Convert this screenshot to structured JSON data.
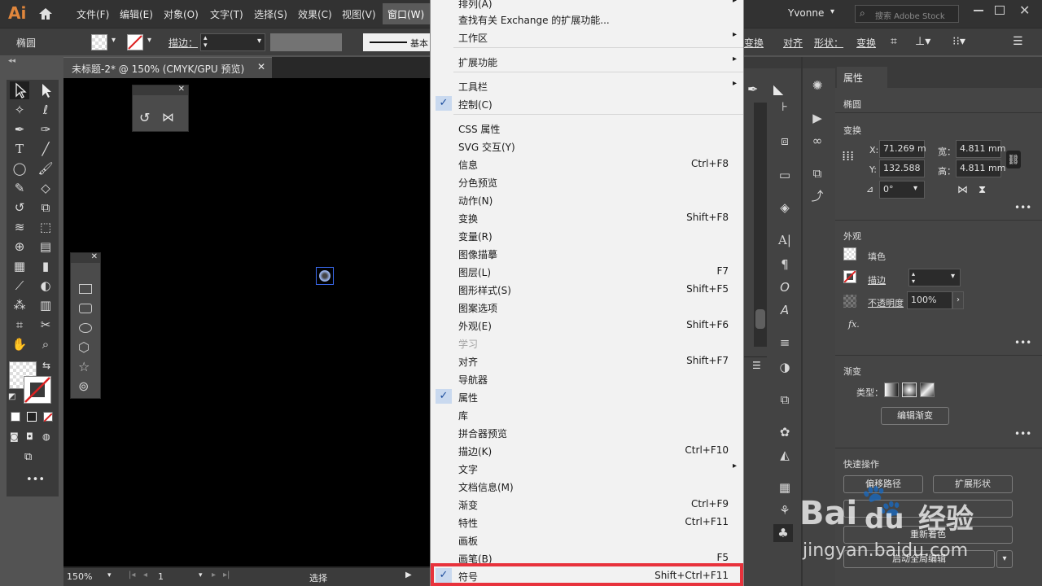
{
  "app": {
    "logo": "Ai"
  },
  "menubar": {
    "items": [
      "文件(F)",
      "编辑(E)",
      "对象(O)",
      "文字(T)",
      "选择(S)",
      "效果(C)",
      "视图(V)",
      "窗口(W)"
    ],
    "user": "Yvonne",
    "search_placeholder": "搜索 Adobe Stock"
  },
  "control": {
    "object_type": "椭圆",
    "stroke_label": "描边：",
    "stroke_profile": "基本",
    "transform": "变换",
    "align": "对齐",
    "shape": "形状：",
    "transform2": "变换"
  },
  "document": {
    "tab_title": "未标题-2* @ 150% (CMYK/GPU 预览)",
    "zoom": "150%",
    "artboard": "1",
    "status": "选择"
  },
  "window_menu": {
    "items": [
      {
        "label": "排列(A)",
        "arrow": true
      },
      {
        "label": "查找有关 Exchange 的扩展功能..."
      },
      {
        "label": "工作区",
        "arrow": true
      },
      {
        "label": "扩展功能",
        "arrow": true,
        "sep_before": true
      },
      {
        "label": "工具栏",
        "arrow": true,
        "sep_before": true
      },
      {
        "label": "控制(C)",
        "checked": true
      },
      {
        "label": "CSS 属性",
        "sep_before": true
      },
      {
        "label": "SVG 交互(Y)"
      },
      {
        "label": "信息",
        "shortcut": "Ctrl+F8"
      },
      {
        "label": "分色预览"
      },
      {
        "label": "动作(N)"
      },
      {
        "label": "变换",
        "shortcut": "Shift+F8"
      },
      {
        "label": "变量(R)"
      },
      {
        "label": "图像描摹"
      },
      {
        "label": "图层(L)",
        "shortcut": "F7"
      },
      {
        "label": "图形样式(S)",
        "shortcut": "Shift+F5"
      },
      {
        "label": "图案选项"
      },
      {
        "label": "外观(E)",
        "shortcut": "Shift+F6"
      },
      {
        "label": "学习",
        "disabled": true
      },
      {
        "label": "对齐",
        "shortcut": "Shift+F7"
      },
      {
        "label": "导航器"
      },
      {
        "label": "属性",
        "checked": true
      },
      {
        "label": "库"
      },
      {
        "label": "拼合器预览"
      },
      {
        "label": "描边(K)",
        "shortcut": "Ctrl+F10"
      },
      {
        "label": "文字",
        "arrow": true
      },
      {
        "label": "文档信息(M)"
      },
      {
        "label": "渐变",
        "shortcut": "Ctrl+F9"
      },
      {
        "label": "特性",
        "shortcut": "Ctrl+F11"
      },
      {
        "label": "画板"
      },
      {
        "label": "画笔(B)",
        "shortcut": "F5"
      },
      {
        "label": "符号",
        "shortcut": "Shift+Ctrl+F11",
        "checked": true,
        "highlighted": true
      }
    ]
  },
  "properties_panel": {
    "tab": "属性",
    "object": "椭圆",
    "transform_title": "变换",
    "x_label": "X:",
    "x": "71.269 m",
    "y_label": "Y:",
    "y": "132.588",
    "w_label": "宽：",
    "w": "4.811 mm",
    "h_label": "高：",
    "h": "4.811 mm",
    "angle": "0°",
    "appearance_title": "外观",
    "fill": "填色",
    "stroke": "描边",
    "opacity_label": "不透明度",
    "opacity": "100%",
    "fx": "fx.",
    "gradient_title": "渐变",
    "gradient_type": "类型：",
    "edit_gradient": "编辑渐变",
    "quick_actions": "快速操作",
    "offset_path": "偏移路径",
    "expand_shape": "扩展形状",
    "recolor": "重新着色",
    "global_edit": "启动全局编辑"
  },
  "watermark": {
    "brand": "Bai",
    "brand2": "du",
    "brand3": "经验",
    "url": "jingyan.baidu.com"
  },
  "colors": {
    "menubar": "#323232",
    "canvas": "#000000",
    "menu_bg": "#f2f2f2",
    "highlight": "#e8323c",
    "check": "#1c4d9c"
  },
  "icons": [
    "home-icon",
    "selection-tool-icon",
    "direct-selection-tool-icon",
    "magic-wand-icon",
    "lasso-icon",
    "pen-icon",
    "type-icon",
    "line-icon",
    "ellipse-icon",
    "paintbrush-icon",
    "shaper-icon",
    "eraser-icon",
    "rotate-icon",
    "scale-icon",
    "width-icon",
    "free-transform-icon",
    "shape-builder-icon",
    "perspective-icon",
    "mesh-icon",
    "gradient-icon",
    "eyedropper-icon",
    "blend-icon",
    "symbol-sprayer-icon",
    "graph-icon",
    "artboard-icon",
    "slice-icon",
    "hand-icon",
    "zoom-icon",
    "search-icon",
    "link-icon"
  ]
}
